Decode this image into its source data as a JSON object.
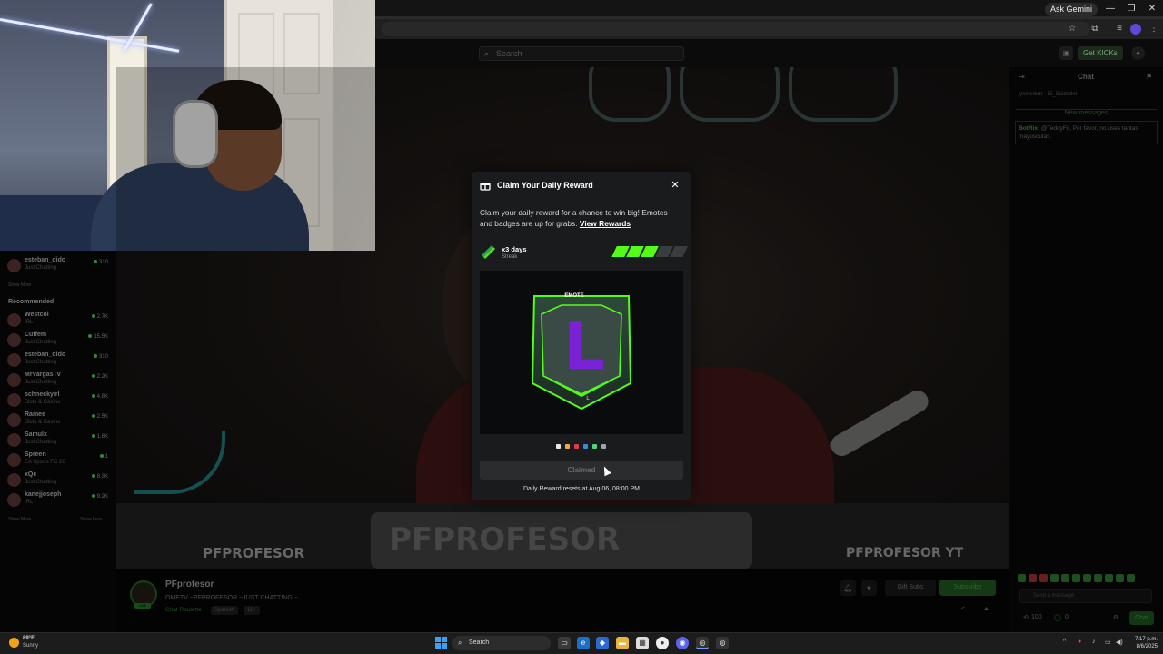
{
  "browser": {
    "ask_gemini": "Ask Gemini",
    "minimize": "—",
    "restore": "❐",
    "close": "✕"
  },
  "kick_nav": {
    "search_placeholder": "Search",
    "get_kicks": "Get KICKs"
  },
  "sidebar": {
    "following": [
      {
        "name": "esteban_dido",
        "category": "Just Chatting",
        "viewers": "310"
      }
    ],
    "show_more_top": "Show More",
    "recommended_heading": "Recommended",
    "recommended": [
      {
        "name": "Westcol",
        "category": "IRL",
        "viewers": "2.7K"
      },
      {
        "name": "Cuffem",
        "category": "Just Chatting",
        "viewers": "15.5K"
      },
      {
        "name": "esteban_dido",
        "category": "Just Chatting",
        "viewers": "310"
      },
      {
        "name": "MrVargasTv",
        "category": "Just Chatting",
        "viewers": "2.2K"
      },
      {
        "name": "schneckyirl",
        "category": "Slots & Casino",
        "viewers": "4.8K"
      },
      {
        "name": "Ramee",
        "category": "Slots & Casino",
        "viewers": "2.5K"
      },
      {
        "name": "Samulx",
        "category": "Just Chatting",
        "viewers": "1.6K"
      },
      {
        "name": "Spreen",
        "category": "EA Sports FC 26",
        "viewers": "1"
      },
      {
        "name": "xQc",
        "category": "Just Chatting",
        "viewers": "8.3K"
      },
      {
        "name": "kanejjoseph",
        "category": "IRL",
        "viewers": "9.2K"
      }
    ],
    "show_more": "Show More",
    "show_less": "Show Less"
  },
  "video": {
    "banner_left": "PFPROFESOR",
    "banner_center": "PFPROFESOR",
    "banner_right": "PFPROFESOR YT"
  },
  "chat": {
    "title": "Chat",
    "pinned_users": "yelnerbrrr · El_Soldadel",
    "new_messages": "New messages",
    "bot_name": "BotRix:",
    "bot_text": "@TeddyFit, Por favor, no uses tantas mayúsculas.",
    "input_placeholder": "Send a message",
    "points": "100",
    "zero": "0",
    "chat_button": "Chat"
  },
  "stream": {
    "streamer": "PFprofesor",
    "live": "LIVE",
    "title": "OMETV ~PFPROFESOR ~JUST CHATTING ~",
    "category": "Chat Roulette",
    "tags": [
      "Spanish",
      "18+"
    ],
    "gift_subs": "Gift Subs",
    "subscribe": "Subscribe"
  },
  "modal": {
    "title": "Claim Your Daily Reward",
    "close": "✕",
    "description": "Claim your daily reward for a chance to win big! Emotes and badges are up for grabs.",
    "view_rewards": "View Rewards",
    "streak_days": "x3 days",
    "streak_label": "Streak",
    "streak_total": 5,
    "streak_filled": 3,
    "reward_type": "EMOTE",
    "reward_glyph": "L",
    "reward_name": "L",
    "swatch_colors": [
      "#e8e8e8",
      "#f0a83a",
      "#e23a4a",
      "#3a8ae0",
      "#53d57b",
      "#9aa4ae"
    ],
    "claimed_button": "Claimed",
    "reset_text": "Daily Reward resets at Aug 06, 08:00 PM"
  },
  "taskbar": {
    "temperature": "89°F",
    "condition": "Sunny",
    "search": "Search",
    "time": "7:17 p.m.",
    "date": "8/6/2025"
  },
  "colors": {
    "kick_green": "#53fc18",
    "modal_bg": "#191b1d",
    "emote_purple": "#7a22d6"
  }
}
